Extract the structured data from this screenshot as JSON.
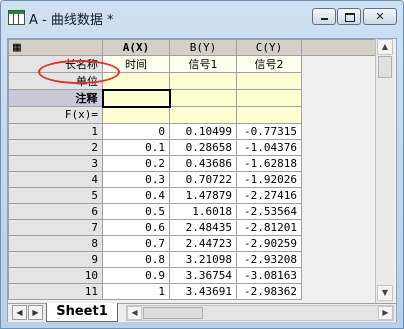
{
  "window": {
    "title": "A - 曲线数据 *",
    "controls": {
      "minimize": "minimize-button",
      "maximize": "maximize-button",
      "close_glyph": "✕"
    }
  },
  "columns": {
    "x": {
      "header": "A(X)",
      "long_name": "时间"
    },
    "b": {
      "header": "B(Y)",
      "long_name": "信号1"
    },
    "c": {
      "header": "C(Y)",
      "long_name": "信号2"
    }
  },
  "row_labels": {
    "long_name": "长名称",
    "units": "单位",
    "comments": "注释",
    "formula": "F(x)="
  },
  "rows": [
    {
      "n": "1",
      "a": "0",
      "b": "0.10499",
      "c": "-0.77315"
    },
    {
      "n": "2",
      "a": "0.1",
      "b": "0.28658",
      "c": "-1.04376"
    },
    {
      "n": "3",
      "a": "0.2",
      "b": "0.43686",
      "c": "-1.62818"
    },
    {
      "n": "4",
      "a": "0.3",
      "b": "0.70722",
      "c": "-1.92026"
    },
    {
      "n": "5",
      "a": "0.4",
      "b": "1.47879",
      "c": "-2.27416"
    },
    {
      "n": "6",
      "a": "0.5",
      "b": "1.6018",
      "c": "-2.53564"
    },
    {
      "n": "7",
      "a": "0.6",
      "b": "2.48435",
      "c": "-2.81201"
    },
    {
      "n": "8",
      "a": "0.7",
      "b": "2.44723",
      "c": "-2.90259"
    },
    {
      "n": "9",
      "a": "0.8",
      "b": "3.21098",
      "c": "-2.93208"
    },
    {
      "n": "10",
      "a": "0.9",
      "b": "3.36754",
      "c": "-3.08163"
    },
    {
      "n": "11",
      "a": "1",
      "b": "3.43691",
      "c": "-2.98362"
    }
  ],
  "sheet_tab": "Sheet1",
  "colors": {
    "highlight_circle": "#e03030",
    "title_bar": "#cfe0f2"
  }
}
